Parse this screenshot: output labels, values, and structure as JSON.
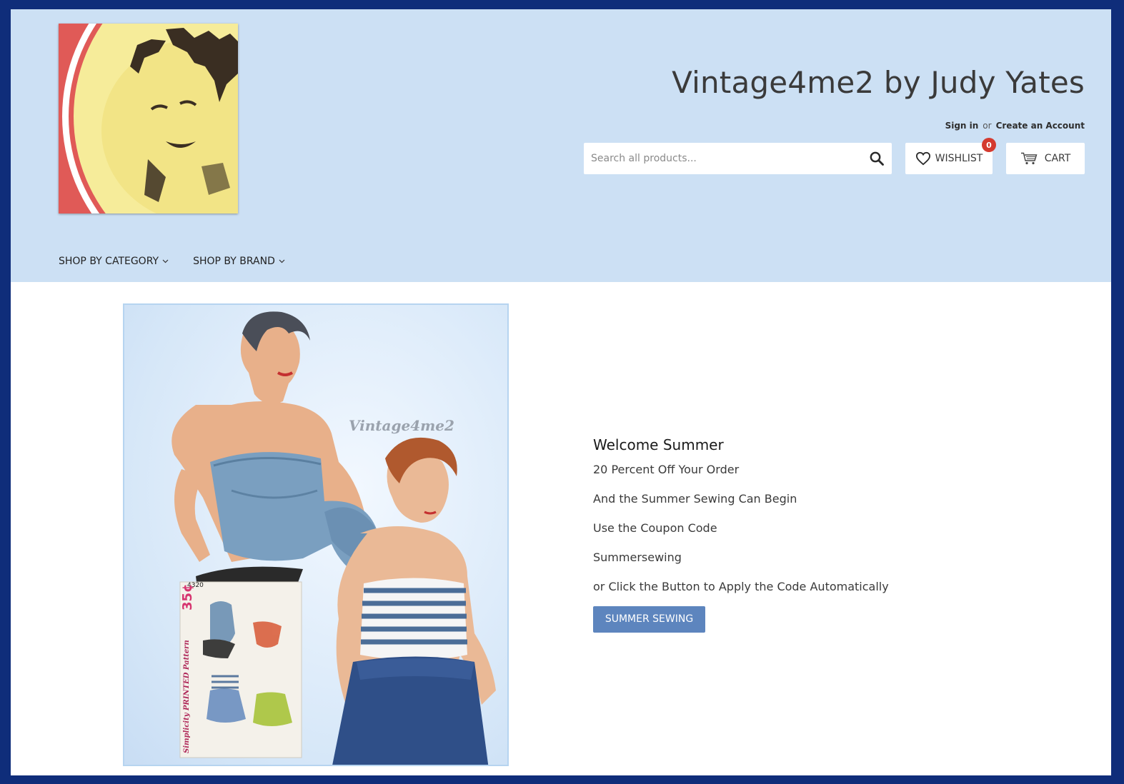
{
  "header": {
    "store_title": "Vintage4me2 by Judy Yates",
    "sign_in": "Sign in",
    "or": "or",
    "create_account": "Create an Account",
    "search_placeholder": "Search all products...",
    "wishlist_label": "WISHLIST",
    "wishlist_count": "0",
    "cart_label": "CART"
  },
  "nav": {
    "items": [
      {
        "label": "SHOP BY CATEGORY"
      },
      {
        "label": "SHOP BY BRAND"
      }
    ]
  },
  "hero": {
    "watermark": "Vintage4me2",
    "pattern_number": "4320",
    "pattern_price": "35¢",
    "pattern_brand": "Simplicity PRINTED Pattern"
  },
  "promo": {
    "heading": "Welcome Summer",
    "lines": [
      "20 Percent Off Your Order",
      "And the Summer Sewing Can Begin",
      "Use the Coupon Code",
      "Summersewing",
      "or Click the Button to Apply the Code Automatically"
    ],
    "button_label": "SUMMER SEWING"
  },
  "colors": {
    "frame": "#0f2d7a",
    "header_bg": "#cce0f4",
    "button": "#5d85be",
    "badge": "#d43a2f"
  }
}
